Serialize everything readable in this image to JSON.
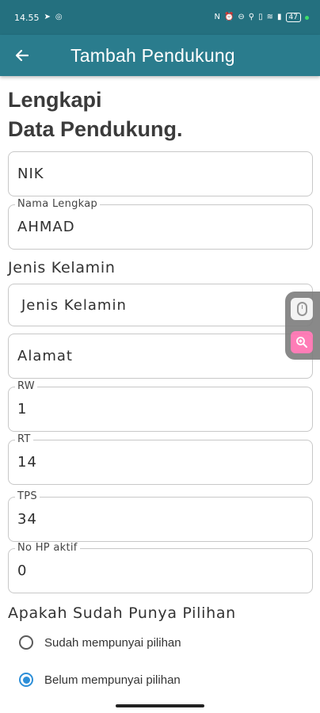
{
  "status_bar": {
    "time": "14.55",
    "left_icons": [
      "telegram-icon",
      "whatsapp-icon"
    ],
    "right_icons": [
      "nfc-icon",
      "alarm-icon",
      "dnd-icon",
      "location-icon",
      "vibrate-icon",
      "wifi-icon",
      "signal-icon"
    ],
    "battery": "47"
  },
  "app_bar": {
    "back_icon": "arrow-left-icon",
    "title": "Tambah Pendukung"
  },
  "heading": {
    "line1": "Lengkapi",
    "line2": "Data Pendukung."
  },
  "form": {
    "nik": {
      "placeholder": "NIK",
      "value": ""
    },
    "nama": {
      "label": "Nama Lengkap",
      "value": "AHMAD"
    },
    "jenis_kelamin_section": "Jenis Kelamin",
    "jenis_kelamin": {
      "placeholder": "Jenis Kelamin",
      "value": ""
    },
    "alamat": {
      "placeholder": "Alamat",
      "value": ""
    },
    "rw": {
      "label": "RW",
      "value": "1"
    },
    "rt": {
      "label": "RT",
      "value": "14"
    },
    "tps": {
      "label": "TPS",
      "value": "34"
    },
    "hp": {
      "label": "No HP aktif",
      "value": "0"
    },
    "pilihan_section": "Apakah Sudah Punya Pilihan",
    "options": [
      {
        "label": "Sudah mempunyai pilihan",
        "selected": false
      },
      {
        "label": "Belum mempunyai pilihan",
        "selected": true
      }
    ]
  },
  "floating_tool": {
    "icons": [
      "mouse-icon",
      "zoom-in-icon"
    ]
  },
  "colors": {
    "status_bar": "#24707f",
    "app_bar": "#2a7c8d",
    "radio_selected": "#2d8fd8",
    "zoom_button": "#ff6fb0"
  }
}
